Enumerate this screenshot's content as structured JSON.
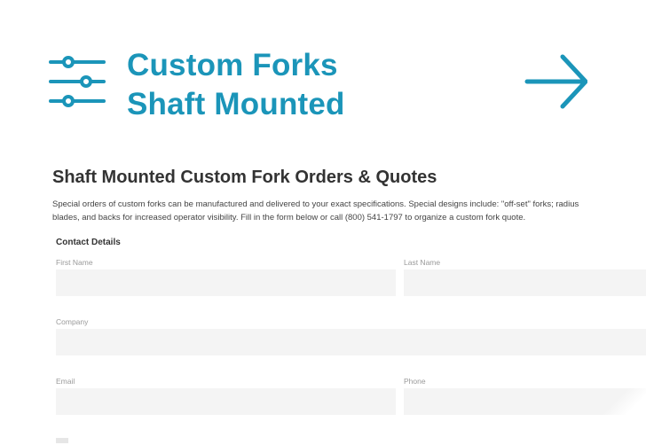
{
  "hero": {
    "title_line1": "Custom Forks",
    "title_line2": "Shaft Mounted",
    "icon": "sliders-icon",
    "arrow_icon": "arrow-right-icon",
    "accent_color": "#1b95b9"
  },
  "form_section": {
    "title": "Shaft Mounted Custom Fork Orders & Quotes",
    "intro_line1": "Special orders of custom forks can be manufactured and delivered to your exact specifications. Special designs include: \"off-set\" forks; radius",
    "intro_line2": "blades, and backs for increased operator visibility. Fill in the form below or call (800) 541-1797 to organize a custom fork quote.",
    "group_heading": "Contact Details",
    "fields": {
      "first_name": {
        "label": "First Name",
        "value": ""
      },
      "last_name": {
        "label": "Last Name",
        "value": ""
      },
      "company": {
        "label": "Company",
        "value": ""
      },
      "email": {
        "label": "Email",
        "value": ""
      },
      "phone": {
        "label": "Phone",
        "value": ""
      }
    }
  }
}
